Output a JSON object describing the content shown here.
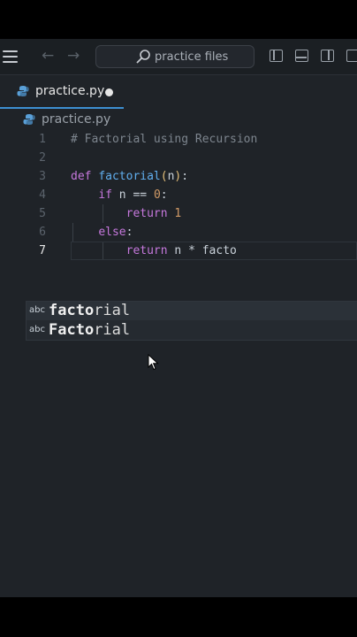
{
  "titlebar": {
    "search_text": "practice files",
    "icons": [
      "hamburger-menu-icon",
      "back-arrow-icon",
      "forward-arrow-icon",
      "search-icon",
      "toggle-primary-sidebar-icon",
      "toggle-panel-icon",
      "toggle-secondary-sidebar-icon",
      "customize-layout-icon"
    ],
    "back_glyph": "←",
    "forward_glyph": "→"
  },
  "tab": {
    "filename": "practice.py",
    "modified": true
  },
  "breadcrumb": {
    "filename": "practice.py"
  },
  "editor": {
    "current_line": 7,
    "line_numbers": [
      "1",
      "2",
      "3",
      "4",
      "5",
      "6",
      "7"
    ],
    "lines": [
      {
        "text": "# Factorial using Recursion"
      },
      {
        "text": ""
      },
      {
        "text": "def factorial(n):"
      },
      {
        "text": "    if n == 0:"
      },
      {
        "text": "        return 1"
      },
      {
        "text": "    else:"
      },
      {
        "text": "        return n * facto"
      }
    ]
  },
  "suggestions": [
    {
      "kind": "abc",
      "label": "factorial"
    },
    {
      "kind": "abc",
      "label": "Factorial"
    }
  ],
  "colors": {
    "keyword": "#c678dd",
    "function": "#61afef",
    "number": "#d19a66",
    "comment": "#7d858e",
    "accent": "#3d8fd1"
  }
}
